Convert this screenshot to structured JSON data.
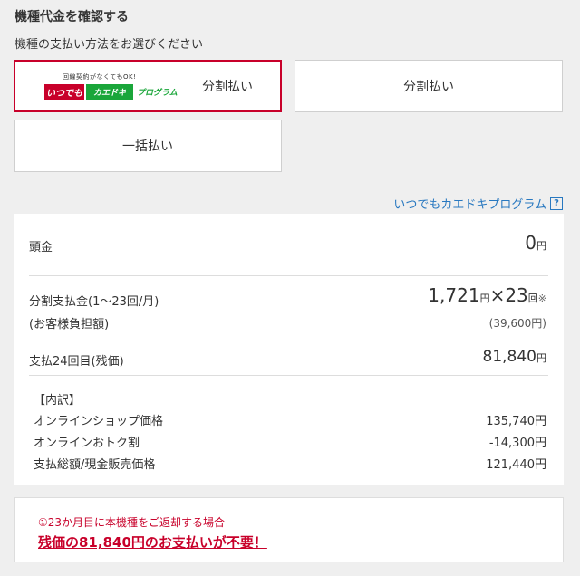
{
  "header": {
    "title": "機種代金を確認する",
    "subtitle": "機種の支払い方法をお選びください"
  },
  "options": {
    "kaedoki": {
      "logo_tagline": "回線契約がなくてもOK!",
      "logo_red": "いつでも",
      "logo_green": "カエドキ",
      "logo_program": "プログラム",
      "label": "分割払い"
    },
    "split": {
      "label": "分割払い"
    },
    "lump": {
      "label": "一括払い"
    }
  },
  "program_link": {
    "label": "いつでもカエドキプログラム",
    "help": "?"
  },
  "panel": {
    "down_payment": {
      "label": "頭金",
      "value": "0",
      "unit": "円"
    },
    "installment": {
      "label_line1": "分割支払金(1〜23回/月)",
      "label_line2": "(お客様負担額)",
      "amount": "1,721",
      "unit": "円",
      "times_symbol": "×",
      "count": "23",
      "count_unit": "回",
      "asterisk": "※",
      "total": "(39,600円)"
    },
    "final_payment": {
      "label": "支払24回目(残価)",
      "value": "81,840",
      "unit": "円"
    },
    "breakdown": {
      "heading": "【内訳】",
      "items": [
        {
          "label": "オンラインショップ価格",
          "value": "135,740円"
        },
        {
          "label": "オンラインおトク割",
          "value": "-14,300円"
        },
        {
          "label": "支払総額/現金販売価格",
          "value": "121,440円"
        }
      ]
    }
  },
  "notice": {
    "small": "①23か月目に本機種をご返却する場合",
    "big": "残価の81,840円のお支払いが不要！"
  },
  "colors": {
    "accent_red": "#c8002a",
    "link_blue": "#2878c0",
    "logo_green": "#1aa63a"
  }
}
